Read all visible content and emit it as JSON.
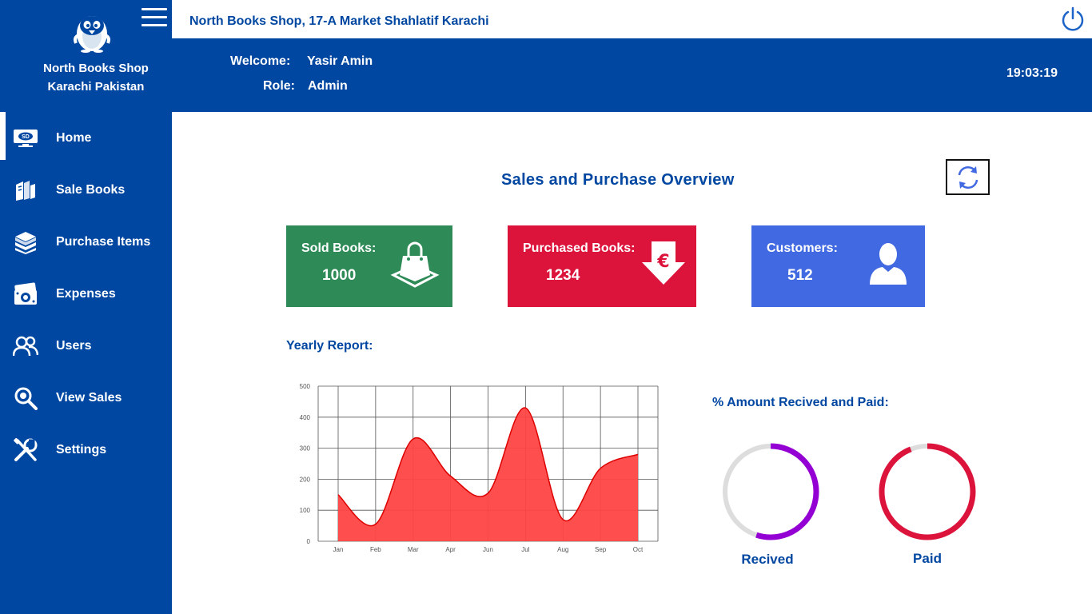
{
  "sidebar": {
    "shop_line1": "North Books Shop",
    "shop_line2": "Karachi Pakistan",
    "logo_icon": "penguin-logo-icon",
    "menu_icon": "hamburger-menu-icon",
    "items": [
      {
        "label": "Home",
        "icon": "home-screen-icon",
        "active": true
      },
      {
        "label": "Sale Books",
        "icon": "books-icon"
      },
      {
        "label": "Purchase Items",
        "icon": "book-stack-icon"
      },
      {
        "label": "Expenses",
        "icon": "cash-icon"
      },
      {
        "label": "Users",
        "icon": "users-icon"
      },
      {
        "label": "View Sales",
        "icon": "search-icon"
      },
      {
        "label": "Settings",
        "icon": "tools-icon"
      }
    ]
  },
  "topbar": {
    "title": "North Books Shop, 17-A Market Shahlatif Karachi",
    "power_icon": "power-icon"
  },
  "header": {
    "welcome_label": "Welcome:",
    "welcome_value": "Yasir Amin",
    "role_label": "Role:",
    "role_value": "Admin",
    "clock": "19:03:19"
  },
  "main": {
    "title": "Sales and Purchase Overview",
    "refresh_icon": "refresh-icon",
    "cards": [
      {
        "label": "Sold Books:",
        "value": "1000",
        "color": "#2e8b57",
        "icon": "shopping-bag-icon"
      },
      {
        "label": "Purchased Books:",
        "value": "1234",
        "color": "#dc143c",
        "icon": "euro-down-arrow-icon"
      },
      {
        "label": "Customers:",
        "value": "512",
        "color": "#4169e1",
        "icon": "user-icon"
      }
    ],
    "yearly_label": "Yearly Report:",
    "pct_label": "% Amount Recived and Paid:",
    "rings": [
      {
        "label": "Recived",
        "percent": 55,
        "color": "#9400d3"
      },
      {
        "label": "Paid",
        "percent": 94,
        "color": "#dc143c"
      }
    ]
  },
  "chart_data": {
    "type": "area",
    "x": [
      "Jan",
      "Feb",
      "Mar",
      "Apr",
      "Jun",
      "Jul",
      "Aug",
      "Sep",
      "Oct"
    ],
    "values": [
      150,
      55,
      330,
      210,
      155,
      430,
      70,
      235,
      280
    ],
    "ylim": [
      0,
      500
    ],
    "yticks": [
      0,
      100,
      200,
      300,
      400,
      500
    ],
    "grid": true,
    "color": "#ff4444",
    "line_color": "#dd0000"
  }
}
